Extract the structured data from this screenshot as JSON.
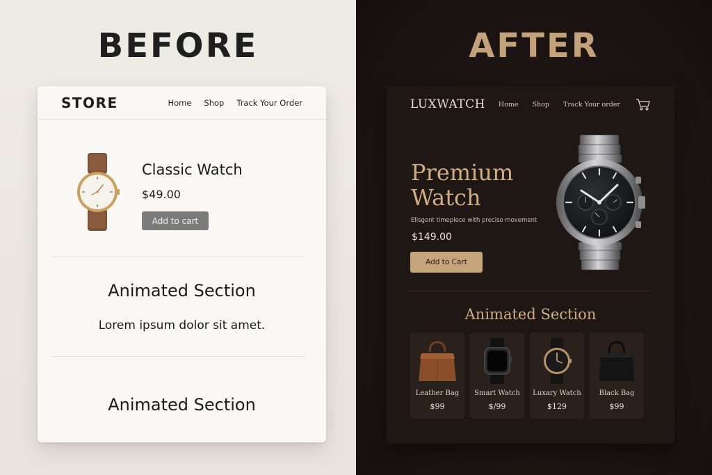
{
  "before": {
    "label": "BEFORE",
    "nav": {
      "logo": "STORE",
      "links": [
        "Home",
        "Shop",
        "Track Your Order"
      ]
    },
    "product": {
      "title": "Classic Watch",
      "price": "$49.00",
      "button": "Add to cart",
      "icon": "wristwatch-brown-strap-icon"
    },
    "section1": {
      "heading": "Animated Section",
      "text": "Lorem ipsum dolor sit amet."
    },
    "section2": {
      "heading": "Animated Section"
    },
    "colors": {
      "background": "#efebe5",
      "card": "#faf8f5",
      "button": "#7b7b7b",
      "text": "#1c1c1c"
    }
  },
  "after": {
    "label": "AFTER",
    "nav": {
      "logo": "LUXWATCH",
      "links": [
        "Home",
        "Shop",
        "Track Your order"
      ],
      "cart_icon": "shopping-cart-icon"
    },
    "hero": {
      "title": "Premium Watch",
      "description": "Elisgent timeplece with preciso movement",
      "price": "$149.00",
      "button": "Add to Cart",
      "icon": "steel-chronograph-watch-icon"
    },
    "section": {
      "heading": "Animated Section"
    },
    "products": [
      {
        "name": "Leather Bag",
        "price": "$99",
        "icon": "leather-bag-icon"
      },
      {
        "name": "Smart Watch",
        "price": "$/99",
        "icon": "smart-watch-icon"
      },
      {
        "name": "Luxary Watch",
        "price": "$129",
        "icon": "luxury-watch-icon"
      },
      {
        "name": "Black Bag",
        "price": "$99",
        "icon": "black-bag-icon"
      }
    ],
    "colors": {
      "background": "#1a1311",
      "card": "#1e1714",
      "accent": "#c7a57a",
      "heading": "#cfae84",
      "tile": "#2a211d"
    }
  }
}
